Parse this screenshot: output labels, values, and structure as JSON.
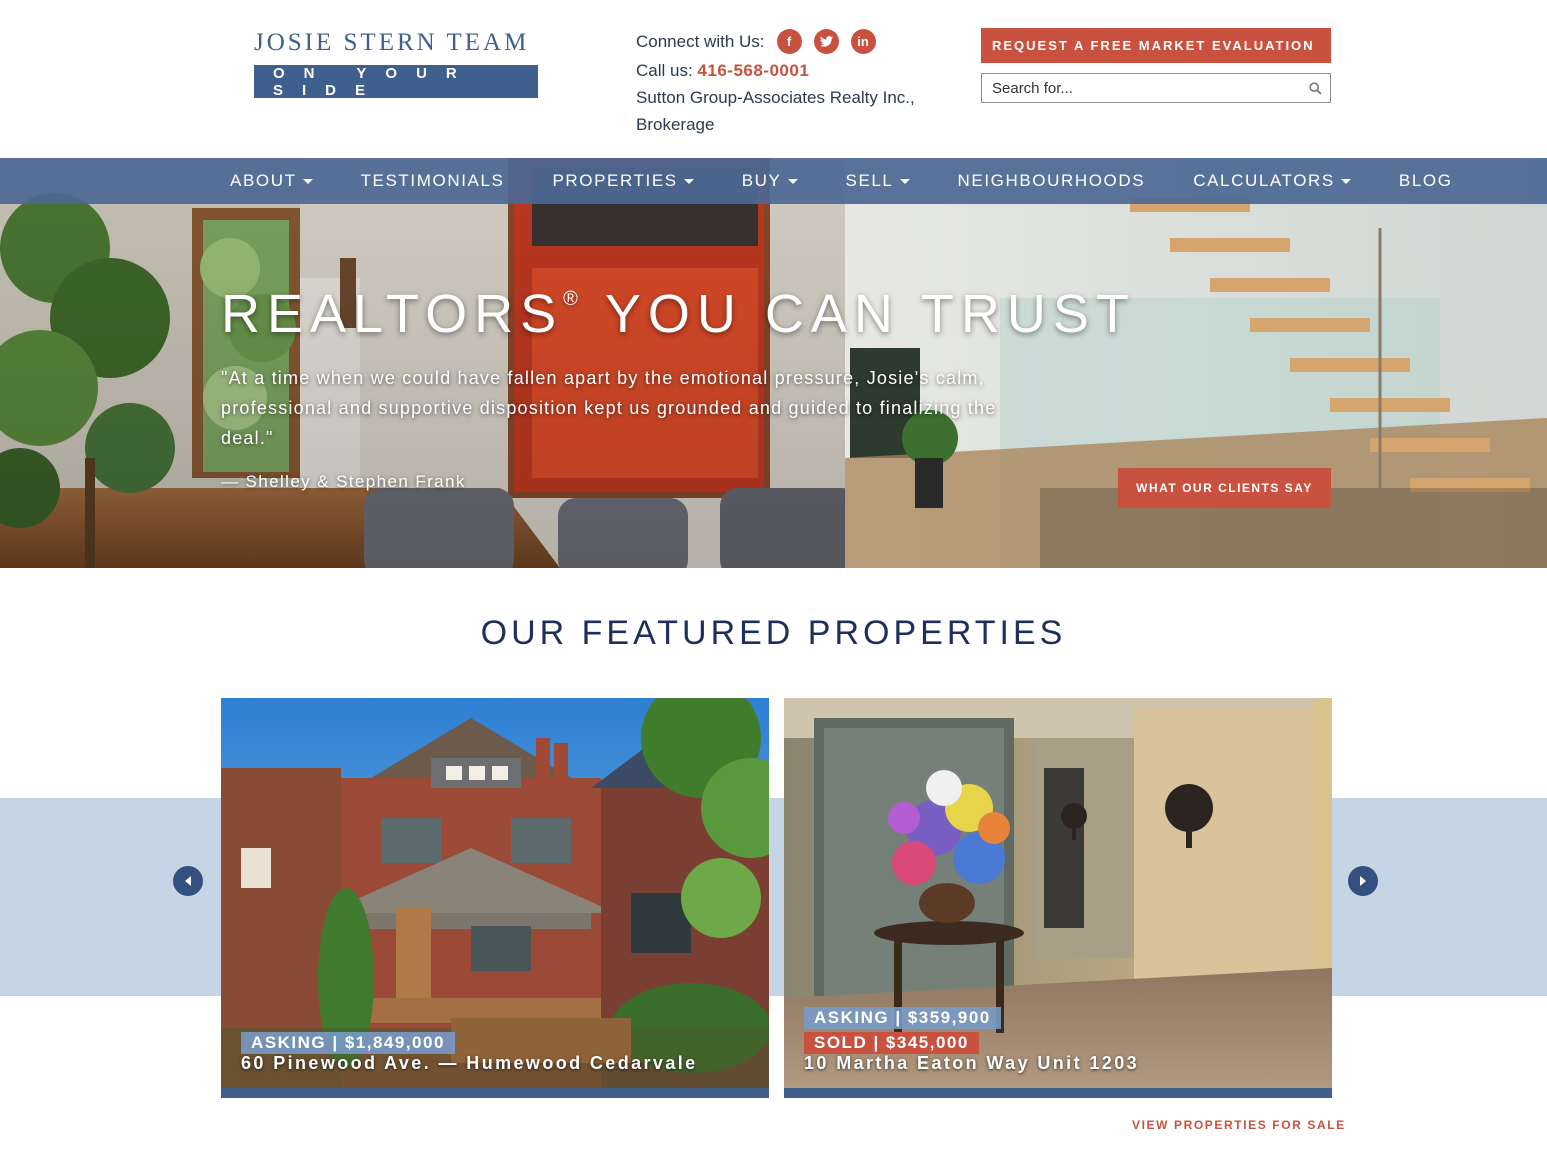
{
  "header": {
    "logo_title": "JOSIE STERN TEAM",
    "logo_tagline": "ON YOUR SIDE",
    "connect_label": "Connect with Us:",
    "social": [
      {
        "icon": "facebook-icon",
        "glyph": "f"
      },
      {
        "icon": "twitter-icon",
        "glyph": "t"
      },
      {
        "icon": "linkedin-icon",
        "glyph": "in"
      }
    ],
    "call_label": "Call us:",
    "phone": "416-568-0001",
    "brokerage_line1": "Sutton Group-Associates Realty Inc.,",
    "brokerage_line2": "Brokerage",
    "cta_label": "REQUEST A FREE MARKET EVALUATION",
    "search_placeholder": "Search for..."
  },
  "nav": {
    "items": [
      {
        "label": "ABOUT",
        "dropdown": true
      },
      {
        "label": "TESTIMONIALS",
        "dropdown": false
      },
      {
        "label": "PROPERTIES",
        "dropdown": true
      },
      {
        "label": "BUY",
        "dropdown": true
      },
      {
        "label": "SELL",
        "dropdown": true
      },
      {
        "label": "NEIGHBOURHOODS",
        "dropdown": false
      },
      {
        "label": "CALCULATORS",
        "dropdown": true
      },
      {
        "label": "BLOG",
        "dropdown": false
      }
    ]
  },
  "hero": {
    "title": "REALTORS",
    "title_mark": "®",
    "title_rest": "YOU CAN TRUST",
    "quote": "\"At a time when we could have fallen apart by the emotional pressure, Josie's calm, professional and supportive disposition kept us grounded and guided to finalizing the deal.\"",
    "author": "— Shelley & Stephen Frank",
    "button": "WHAT OUR CLIENTS SAY"
  },
  "featured": {
    "title": "OUR FEATURED PROPERTIES",
    "properties": [
      {
        "asking": "ASKING | $1,849,000",
        "sold": "",
        "address": "60 Pinewood Ave. — Humewood Cedarvale"
      },
      {
        "asking": "ASKING | $359,900",
        "sold": "SOLD | $345,000",
        "address": "10 Martha Eaton Way Unit 1203"
      }
    ],
    "view_link": "VIEW PROPERTIES FOR SALE"
  },
  "colors": {
    "brand_blue": "#3f5f8f",
    "accent_red": "#c9513f",
    "heading_navy": "#1d2f5c",
    "band_blue": "#c5d5e5"
  }
}
